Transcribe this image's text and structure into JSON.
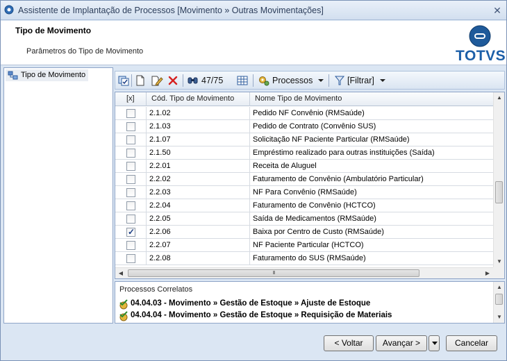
{
  "window": {
    "title": "Assistente de Implantação de Processos [Movimento » Outras Movimentações]",
    "close_glyph": "✕"
  },
  "header": {
    "title": "Tipo de Movimento",
    "subtitle": "Parâmetros do Tipo de Movimento",
    "logo_text": "TOTVS"
  },
  "tree": {
    "items": [
      {
        "label": "Tipo de Movimento",
        "icon": "process-tree-icon"
      }
    ]
  },
  "toolbar": {
    "record_counter": "47/75",
    "processes_label": "Processos",
    "filter_label": "[Filtrar]",
    "icons": [
      "select-all-icon",
      "new-icon",
      "edit-icon",
      "delete-icon",
      "find-icon",
      "grid-view-icon",
      "processes-icon",
      "filter-icon"
    ]
  },
  "grid": {
    "columns": [
      "[x]",
      "Cód. Tipo de Movimento",
      "Nome Tipo de Movimento"
    ],
    "rows": [
      {
        "checked": false,
        "code": "2.1.02",
        "name": "Pedido NF Convênio (RMSaúde)"
      },
      {
        "checked": false,
        "code": "2.1.03",
        "name": "Pedido de Contrato (Convênio SUS)"
      },
      {
        "checked": false,
        "code": "2.1.07",
        "name": "Solicitação NF Paciente Particular (RMSaúde)"
      },
      {
        "checked": false,
        "code": "2.1.50",
        "name": "Empréstimo realizado para outras instituições (Saída)"
      },
      {
        "checked": false,
        "code": "2.2.01",
        "name": "Receita de Aluguel"
      },
      {
        "checked": false,
        "code": "2.2.02",
        "name": "Faturamento de Convênio (Ambulatório Particular)"
      },
      {
        "checked": false,
        "code": "2.2.03",
        "name": "NF Para Convênio (RMSaúde)"
      },
      {
        "checked": false,
        "code": "2.2.04",
        "name": "Faturamento de Convênio (HCTCO)"
      },
      {
        "checked": false,
        "code": "2.2.05",
        "name": "Saída de Medicamentos (RMSaúde)"
      },
      {
        "checked": true,
        "code": "2.2.06",
        "name": "Baixa por Centro de Custo (RMSaúde)"
      },
      {
        "checked": false,
        "code": "2.2.07",
        "name": "NF Paciente Particular (HCTCO)"
      },
      {
        "checked": false,
        "code": "2.2.08",
        "name": "Faturamento do SUS (RMSaúde)"
      }
    ],
    "check_glyph": "✓",
    "scroll_up_glyph": "▲",
    "scroll_down_glyph": "▼",
    "scroll_left_glyph": "◀",
    "scroll_right_glyph": "▶",
    "hthumb_grip": "III"
  },
  "related": {
    "title": "Processos Correlatos",
    "items": [
      "04.04.03 - Movimento » Gestão de Estoque » Ajuste de Estoque",
      "04.04.04 - Movimento » Gestão de Estoque » Requisição de Materiais"
    ]
  },
  "buttons": {
    "back": "< Voltar",
    "next": "Avançar >",
    "cancel": "Cancelar"
  },
  "colors": {
    "accent": "#1c5fa8",
    "window_bg": "#dbe6f3",
    "check": "#1d3f86"
  }
}
